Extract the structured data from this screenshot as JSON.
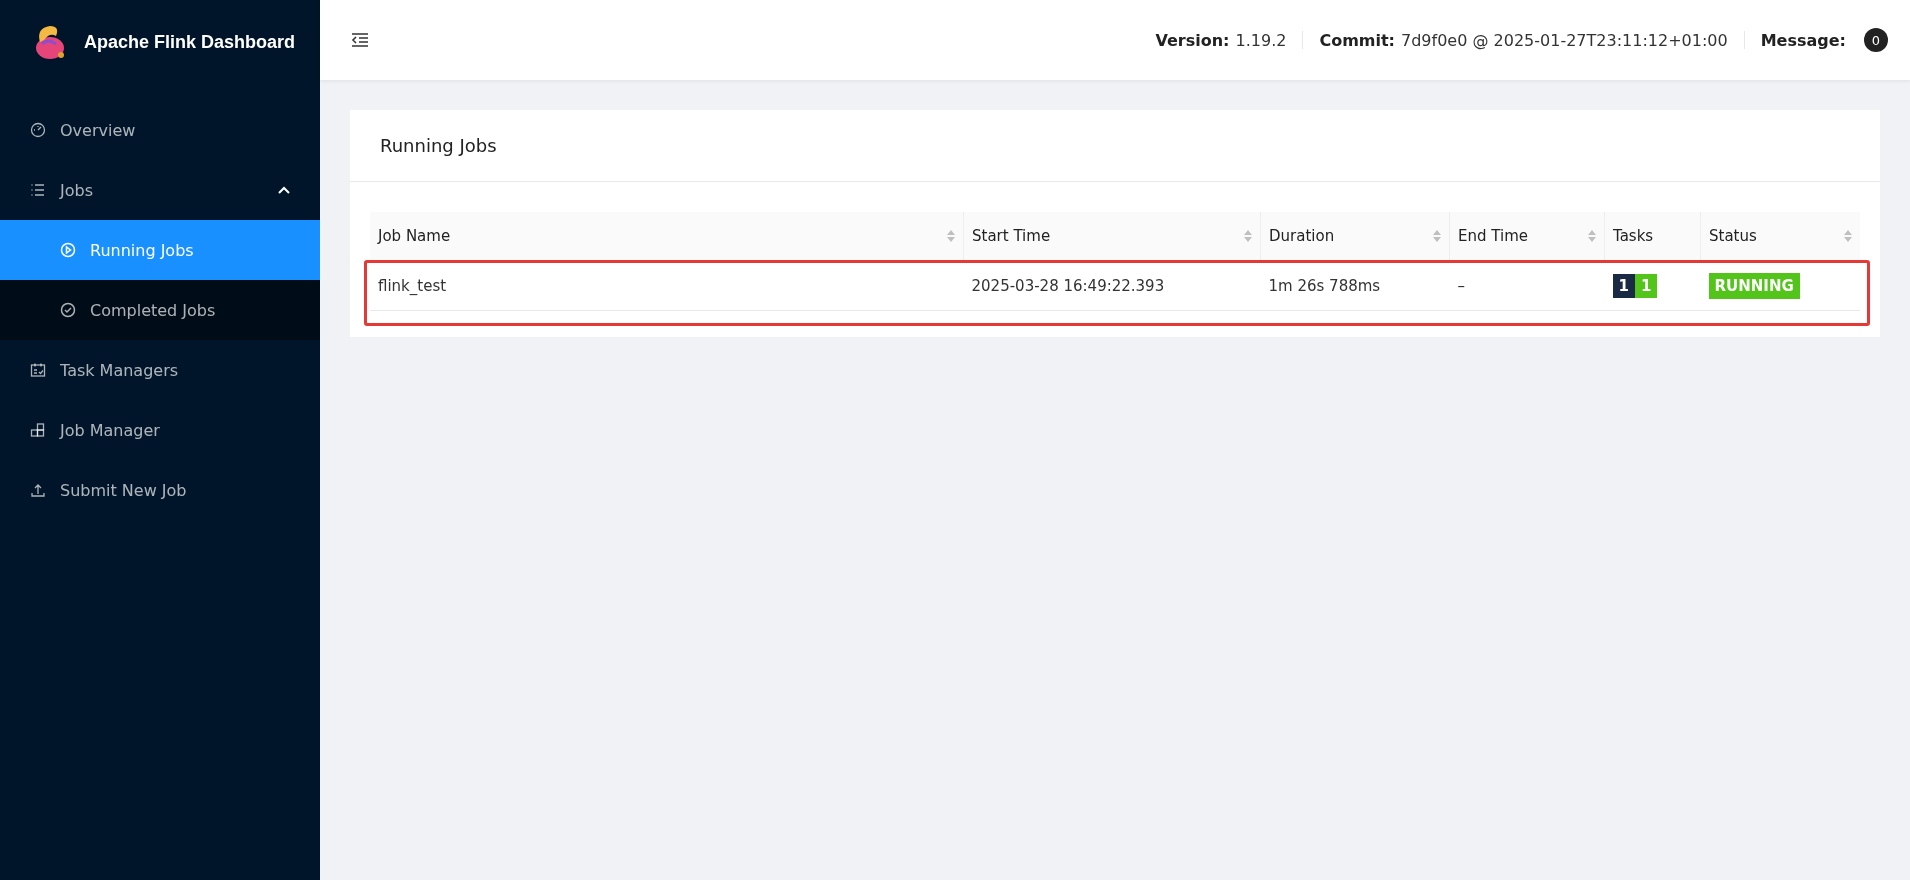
{
  "sidebar": {
    "title": "Apache Flink Dashboard",
    "items": [
      {
        "label": "Overview",
        "selected": false
      },
      {
        "label": "Jobs",
        "selected": false,
        "expanded": true,
        "children": [
          {
            "label": "Running Jobs",
            "selected": true
          },
          {
            "label": "Completed Jobs",
            "selected": false
          }
        ]
      },
      {
        "label": "Task Managers",
        "selected": false
      },
      {
        "label": "Job Manager",
        "selected": false
      },
      {
        "label": "Submit New Job",
        "selected": false
      }
    ]
  },
  "header": {
    "fields": [
      {
        "label": "Version:",
        "value": "1.19.2"
      },
      {
        "label": "Commit:",
        "value": "7d9f0e0 @ 2025-01-27T23:11:12+01:00"
      },
      {
        "label": "Message:"
      }
    ],
    "message_count": "0"
  },
  "card": {
    "title": "Running Jobs",
    "table": {
      "columns": [
        "Job Name",
        "Start Time",
        "Duration",
        "End Time",
        "Tasks",
        "Status"
      ],
      "rows": [
        {
          "job_name": "flink_test",
          "start_time": "2025-03-28 16:49:22.393",
          "duration": "1m 26s 788ms",
          "end_time": "–",
          "tasks": [
            {
              "count": "1",
              "color": "#1a2a44"
            },
            {
              "count": "1",
              "color": "#52c41a"
            }
          ],
          "status": "RUNNING",
          "highlighted": true
        }
      ]
    }
  }
}
